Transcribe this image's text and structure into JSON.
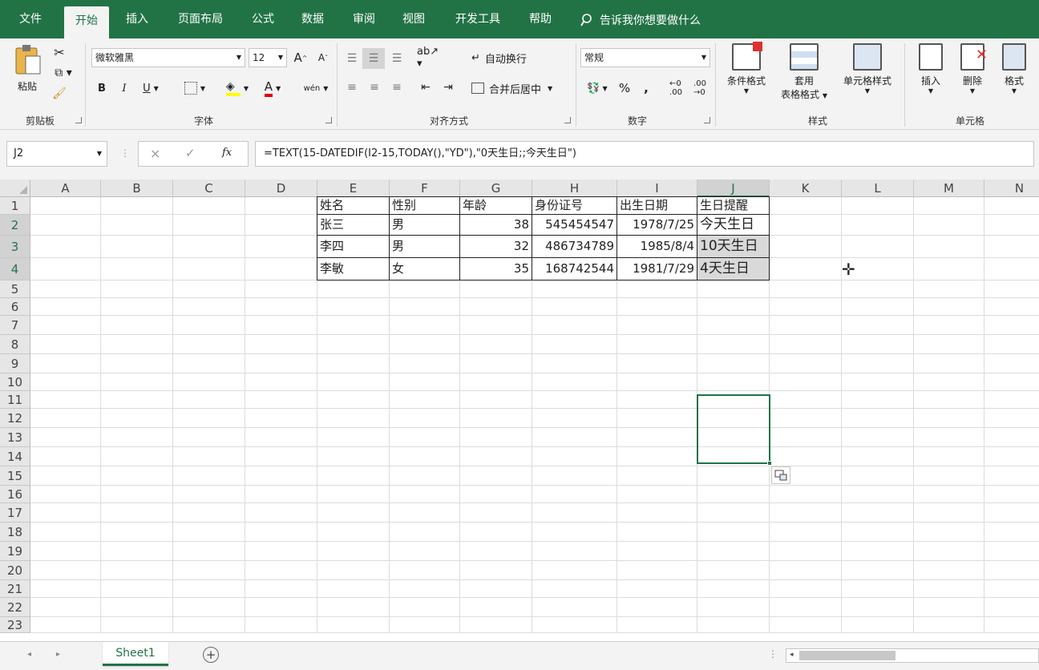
{
  "tabs": [
    "文件",
    "开始",
    "插入",
    "页面布局",
    "公式",
    "数据",
    "审阅",
    "视图",
    "开发工具",
    "帮助"
  ],
  "active_tab": "开始",
  "tell_me": "告诉我你想要做什么",
  "ribbon": {
    "clipboard": {
      "paste": "粘贴",
      "group": "剪贴板"
    },
    "font": {
      "name": "微软雅黑",
      "size": "12",
      "grow": "A",
      "shrink": "A",
      "bold": "B",
      "italic": "I",
      "underline": "U",
      "font_color": "A",
      "phonetic": "wén",
      "group": "字体"
    },
    "alignment": {
      "wrap": "自动换行",
      "merge": "合并后居中",
      "group": "对齐方式"
    },
    "number": {
      "format": "常规",
      "percent": "%",
      "comma": ",",
      "group": "数字"
    },
    "styles": {
      "conditional": "条件格式",
      "table_line1": "套用",
      "table_line2": "表格格式",
      "cell_styles": "单元格样式",
      "group": "样式"
    },
    "cells": {
      "insert": "插入",
      "delete": "删除",
      "format": "格式",
      "group": "单元格"
    }
  },
  "formula_bar": {
    "name_box": "J2",
    "cancel": "×",
    "enter": "✓",
    "fx": "fx",
    "formula": "=TEXT(15-DATEDIF(I2-15,TODAY(),\"YD\"),\"0天生日;;今天生日\")"
  },
  "columns": [
    "A",
    "B",
    "C",
    "D",
    "E",
    "F",
    "G",
    "H",
    "I",
    "J",
    "K",
    "L",
    "M",
    "N"
  ],
  "rows": [
    "1",
    "2",
    "3",
    "4",
    "5",
    "6",
    "7",
    "8",
    "9",
    "10",
    "11",
    "12",
    "13",
    "14",
    "15",
    "16",
    "17",
    "18",
    "19",
    "20",
    "21",
    "22",
    "23"
  ],
  "table": {
    "headers": [
      "姓名",
      "性别",
      "年龄",
      "身份证号",
      "出生日期",
      "生日提醒"
    ],
    "data": [
      [
        "张三",
        "男",
        "38",
        "545454547",
        "1978/7/25",
        "今天生日"
      ],
      [
        "李四",
        "男",
        "32",
        "486734789",
        "1985/8/4",
        "10天生日"
      ],
      [
        "李敏",
        "女",
        "35",
        "168742544",
        "1981/7/29",
        "4天生日"
      ]
    ]
  },
  "sheet": {
    "name": "Sheet1",
    "add": "+"
  }
}
